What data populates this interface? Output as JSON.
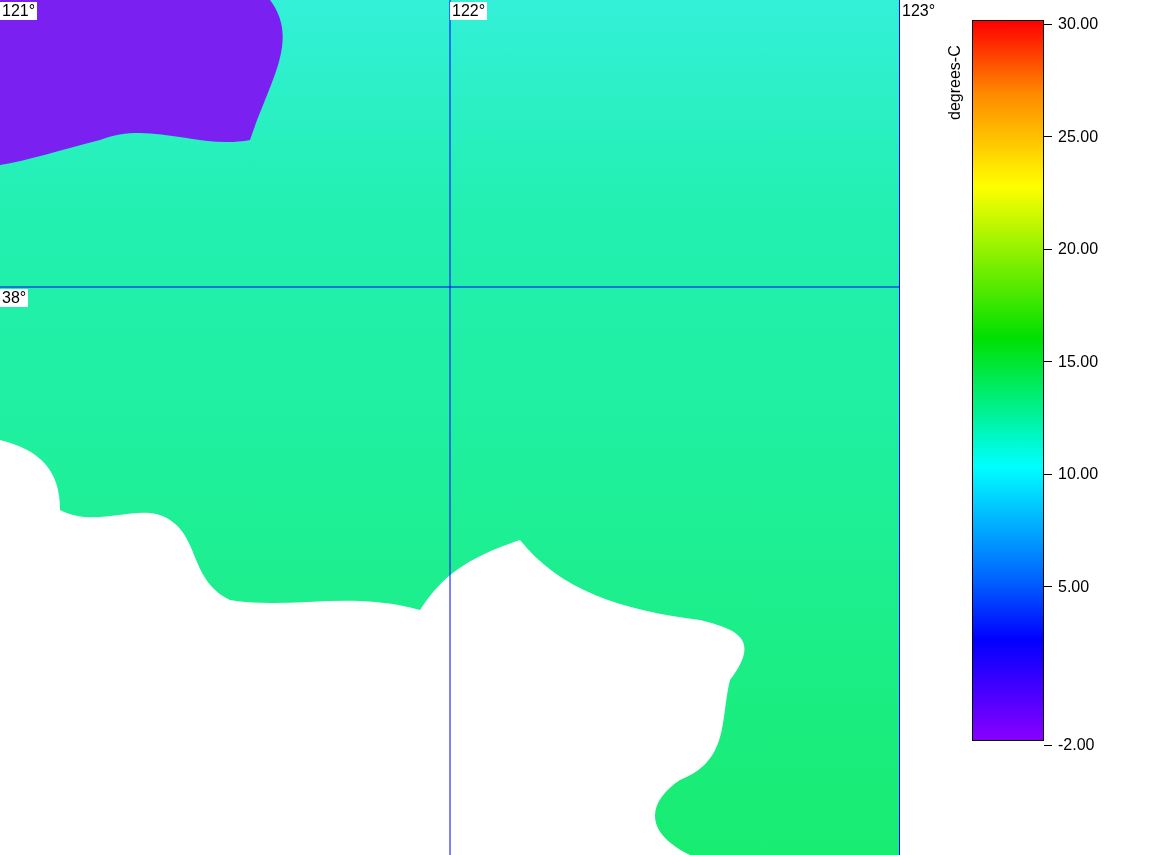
{
  "map": {
    "lon_labels": [
      "121°",
      "122°",
      "123°"
    ],
    "lat_labels": [
      "38°"
    ]
  },
  "legend": {
    "unit": "degrees-C",
    "ticks": [
      "30.00",
      "25.00",
      "20.00",
      "15.00",
      "10.00",
      "5.00",
      "-2.00"
    ]
  }
}
